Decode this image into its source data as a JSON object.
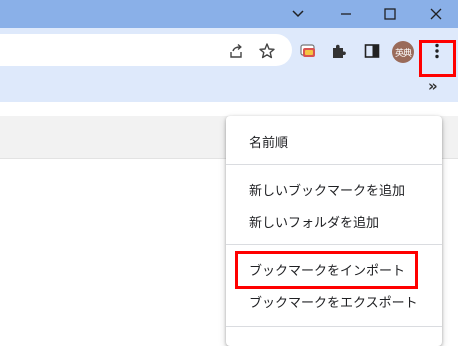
{
  "menu": {
    "items": [
      {
        "label": "名前順"
      },
      {
        "label": "新しいブックマークを追加"
      },
      {
        "label": "新しいフォルダを追加"
      },
      {
        "label": "ブックマークをインポート"
      },
      {
        "label": "ブックマークをエクスポート"
      }
    ]
  },
  "profile": {
    "initials": "英典"
  },
  "bookmarks_bar": {
    "overflow": "»"
  },
  "colors": {
    "titlebar": "#8ab0e8",
    "toolbar": "#dee9fb",
    "highlight": "#ff0000"
  }
}
